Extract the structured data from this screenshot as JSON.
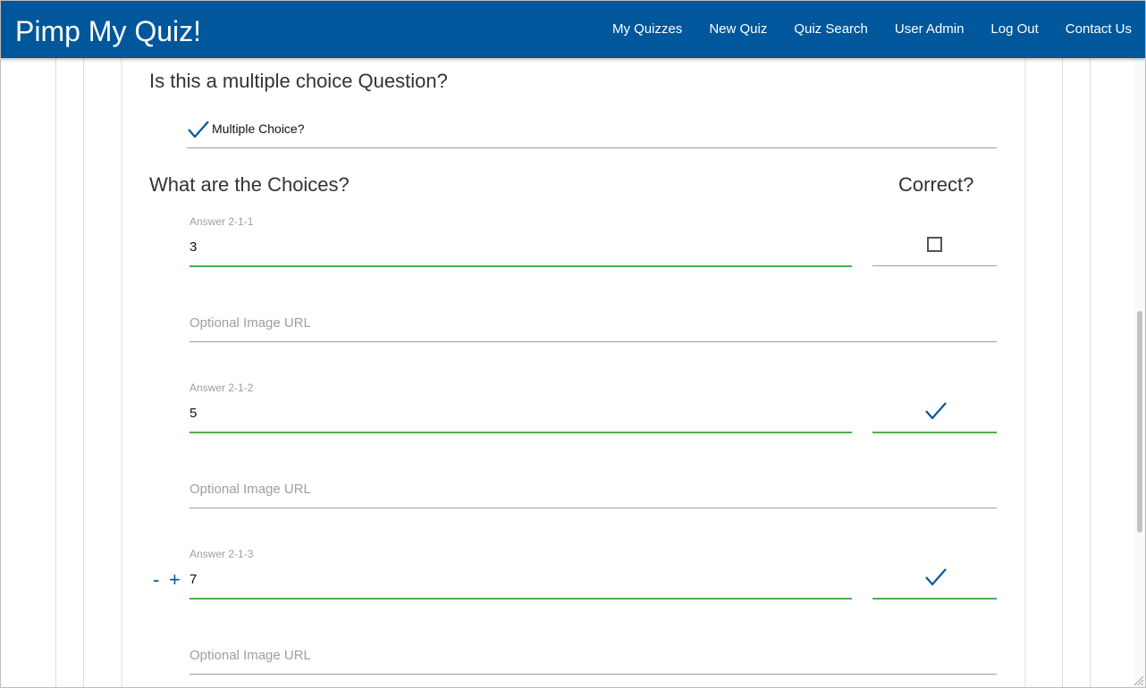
{
  "navbar": {
    "brand": "Pimp My Quiz!",
    "links": [
      "My Quizzes",
      "New Quiz",
      "Quiz Search",
      "User Admin",
      "Log Out",
      "Contact Us"
    ]
  },
  "question": {
    "mc_heading": "Is this a multiple choice Question?",
    "mc_checkbox_label": "Multiple Choice?",
    "mc_checked": true
  },
  "choices": {
    "heading": "What are the Choices?",
    "correct_heading": "Correct?",
    "url_placeholder": "Optional Image URL",
    "answers": [
      {
        "label": "Answer 2-1-1",
        "value": "3",
        "correct": false
      },
      {
        "label": "Answer 2-1-2",
        "value": "5",
        "correct": true
      },
      {
        "label": "Answer 2-1-3",
        "value": "7",
        "correct": true
      }
    ],
    "remove_symbol": "-",
    "add_symbol": "+"
  },
  "colors": {
    "primary": "#01579b",
    "valid": "#4caf50",
    "muted": "#9e9e9e"
  }
}
